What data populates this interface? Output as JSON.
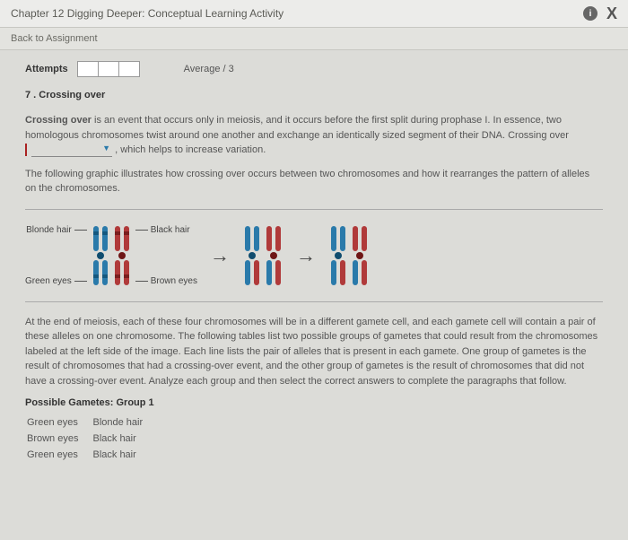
{
  "header": {
    "title": "Chapter 12 Digging Deeper: Conceptual Learning Activity",
    "info_icon": "i",
    "close_icon": "X",
    "back_link": "Back to Assignment"
  },
  "attempts": {
    "label": "Attempts",
    "average_label": "Average / 3"
  },
  "question": {
    "number_title": "7 . Crossing over",
    "p1a": "Crossing over",
    "p1b": " is an event that occurs only in meiosis, and it occurs before the first split during prophase I. In essence, two homologous chromosomes twist around one another and exchange an identically sized segment of their DNA. Crossing over",
    "p1c": " , which helps to increase variation.",
    "p2": "The following graphic illustrates how crossing over occurs between two chromosomes and how it rearranges the pattern of alleles on the chromosomes.",
    "p3": "At the end of meiosis, each of these four chromosomes will be in a different gamete cell, and each gamete cell will contain a pair of these alleles on one chromosome. The following tables list two possible groups of gametes that could result from the chromosomes labeled at the left side of the image. Each line lists the pair of alleles that is present in each gamete. One group of gametes is the result of chromosomes that had a crossing-over event, and the other group of gametes is the result of chromosomes that did not have a crossing-over event. Analyze each group and then select the correct answers to complete the paragraphs that follow."
  },
  "diagram": {
    "left_top": "Blonde hair",
    "left_bottom": "Green eyes",
    "right_top": "Black hair",
    "right_bottom": "Brown eyes"
  },
  "group1": {
    "title": "Possible Gametes: Group 1",
    "rows": [
      [
        "Green eyes",
        "Blonde hair"
      ],
      [
        "Brown eyes",
        "Black hair"
      ],
      [
        "Green eyes",
        "Black hair"
      ]
    ]
  }
}
